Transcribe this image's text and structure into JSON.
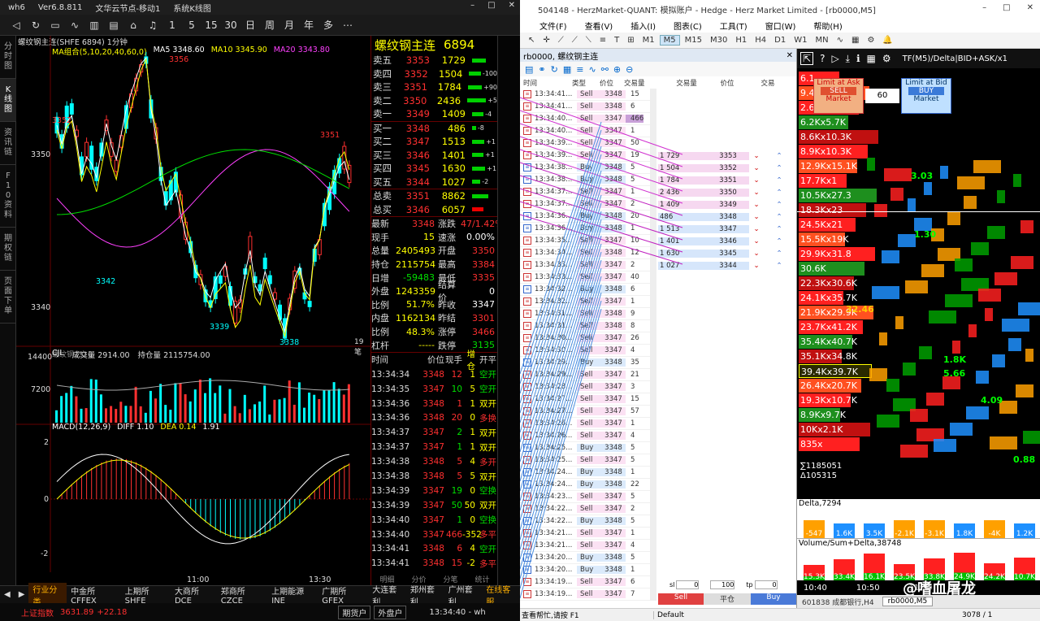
{
  "left": {
    "title": {
      "app": "wh6",
      "version": "Ver6.8.811",
      "cloud": "文华云节点-移动1",
      "kline": "系统K线图"
    },
    "toolbar": [
      "◁",
      "↻",
      "▭",
      "∿",
      "▥",
      "▤",
      "⌂",
      "♫",
      "1",
      "5",
      "15",
      "30",
      "日",
      "周",
      "月",
      "年",
      "多",
      "⋯"
    ],
    "side_tabs": [
      "分时图",
      "K线图",
      "资讯链",
      "F10资料",
      "期权链",
      "页面下单"
    ],
    "symbol_line": "螺纹钢主连(SHFE 6894)  1分钟",
    "ma_line": {
      "label": "MA组合(5,10,20,40,60,0)",
      "ma5": "MA5 3348.60",
      "ma10": "MA10 3345.90",
      "ma20": "MA20 3343.80"
    },
    "price_labels": {
      "p3356": "3356",
      "p3352": "3352",
      "p3351": "3351",
      "p3350": "3350",
      "p3342": "3342",
      "p3340": "3340",
      "p3339": "3339",
      "p3338": "3338",
      "ticks_count": "19笔"
    },
    "vol_line": {
      "label": "CJL",
      "vol": "成交量 2914.00",
      "oi": "持仓量 2115754.00",
      "y1": "14400",
      "y2": "7200",
      "watermark": "螺纹钢2510"
    },
    "macd_line": {
      "label": "MACD(12,26,9)",
      "diff": "DIFF 1.10",
      "dea": "DEA 0.14",
      "macd": "1.91",
      "y2": "2",
      "y0": "0",
      "ym2": "-2"
    },
    "x_axis": [
      "11:00",
      "13:30"
    ],
    "orderbook": {
      "name": "螺纹钢主连",
      "code": "6894",
      "asks": [
        {
          "l": "卖五",
          "p": "3353",
          "v": "1729",
          "c": ""
        },
        {
          "l": "卖四",
          "p": "3352",
          "v": "1504",
          "c": "-100"
        },
        {
          "l": "卖三",
          "p": "3351",
          "v": "1784",
          "c": "+90"
        },
        {
          "l": "卖二",
          "p": "3350",
          "v": "2436",
          "c": "+5"
        },
        {
          "l": "卖一",
          "p": "3349",
          "v": "1409",
          "c": "-4"
        }
      ],
      "bids": [
        {
          "l": "买一",
          "p": "3348",
          "v": "486",
          "c": "-8"
        },
        {
          "l": "买二",
          "p": "3347",
          "v": "1513",
          "c": "+1"
        },
        {
          "l": "买三",
          "p": "3346",
          "v": "1401",
          "c": "+1"
        },
        {
          "l": "买四",
          "p": "3345",
          "v": "1630",
          "c": "+1"
        },
        {
          "l": "买五",
          "p": "3344",
          "v": "1027",
          "c": "-2"
        }
      ],
      "total_ask": {
        "l": "总卖",
        "p": "3351",
        "v": "8862"
      },
      "total_bid": {
        "l": "总买",
        "p": "3346",
        "v": "6057"
      }
    },
    "stats": [
      {
        "k": "最新",
        "v": "3348",
        "k2": "涨跌",
        "v2": "47/1.42%"
      },
      {
        "k": "现手",
        "v": "15",
        "k2": "速涨",
        "v2": "0.00%"
      },
      {
        "k": "总量",
        "v": "2405493",
        "k2": "开盘",
        "v2": "3350"
      },
      {
        "k": "持仓",
        "v": "2115754",
        "k2": "最高",
        "v2": "3384"
      },
      {
        "k": "日增",
        "v": "-59483",
        "k2": "最低",
        "v2": "3335"
      },
      {
        "k": "外盘",
        "v": "1243359",
        "k2": "结算价",
        "v2": "0"
      },
      {
        "k": "比例",
        "v": "51.7%",
        "k2": "昨收",
        "v2": "3347"
      },
      {
        "k": "内盘",
        "v": "1162134",
        "k2": "昨结",
        "v2": "3301"
      },
      {
        "k": "比例",
        "v": "48.3%",
        "k2": "涨停",
        "v2": "3466"
      },
      {
        "k": "杠杆",
        "v": "-----",
        "k2": "跌停",
        "v2": "3135"
      }
    ],
    "ticks_header": [
      "时间",
      "价位",
      "现手",
      "增仓",
      "开平"
    ],
    "ticks": [
      [
        "13:34:34",
        "3348",
        "12",
        "1",
        "空开"
      ],
      [
        "13:34:35",
        "3347",
        "10",
        "5",
        "空开"
      ],
      [
        "13:34:36",
        "3348",
        "1",
        "1",
        "双开"
      ],
      [
        "13:34:36",
        "3348",
        "20",
        "0",
        "多换"
      ],
      [
        "13:34:37",
        "3347",
        "2",
        "1",
        "双开"
      ],
      [
        "13:34:37",
        "3347",
        "1",
        "1",
        "双开"
      ],
      [
        "13:34:38",
        "3348",
        "5",
        "4",
        "多开"
      ],
      [
        "13:34:38",
        "3348",
        "5",
        "5",
        "双开"
      ],
      [
        "13:34:39",
        "3347",
        "19",
        "0",
        "空换"
      ],
      [
        "13:34:39",
        "3347",
        "50",
        "50",
        "双开"
      ],
      [
        "13:34:40",
        "3347",
        "1",
        "0",
        "空换"
      ],
      [
        "13:34:40",
        "3347",
        "466",
        "-352",
        "多平"
      ],
      [
        "13:34:41",
        "3348",
        "6",
        "4",
        "空开"
      ],
      [
        "13:34:41",
        "3348",
        "15",
        "-2",
        "多平"
      ]
    ],
    "ticks_tabs": [
      "明细",
      "分价",
      "分笔",
      "统计"
    ],
    "bottom_tabs": [
      "◀",
      "▶",
      "行业分类",
      "中金所CFFEX",
      "上期所SHFE",
      "大商所DCE",
      "郑商所CZCE",
      "上期能源INE",
      "广期所GFEX",
      "大连套利",
      "郑州套利",
      "广州套利",
      "在线客服"
    ],
    "status": {
      "index": "上证指数",
      "val": "3631.89",
      "chg": "+22.18",
      "b1": "期货户",
      "b2": "外盘户",
      "time": "13:34:40 - wh"
    }
  },
  "right": {
    "title": "504148 - HerzMarket-QUANT: 模拟账户 - Hedge - Herz Market Limited - [rb0000,M5]",
    "menu": [
      "文件(F)",
      "查看(V)",
      "插入(I)",
      "图表(C)",
      "工具(T)",
      "窗口(W)",
      "帮助(H)"
    ],
    "tf": [
      "M1",
      "M5",
      "M15",
      "M30",
      "H1",
      "H4",
      "D1",
      "W1",
      "MN"
    ],
    "active_tf": "M5",
    "dom_head": "rb0000, 螺纹钢主连",
    "trades_header": [
      "时间",
      "类型",
      "价位",
      "交易量"
    ],
    "dom_header": [
      "交易量",
      "价位",
      "交易"
    ],
    "trades": [
      [
        "13:34:41...",
        "Sell",
        "3348",
        "15"
      ],
      [
        "13:34:41...",
        "Sell",
        "3348",
        "6"
      ],
      [
        "13:34:40...",
        "Sell",
        "3347",
        "466"
      ],
      [
        "13:34:40...",
        "Sell",
        "3347",
        "1"
      ],
      [
        "13:34:39...",
        "Sell",
        "3347",
        "50"
      ],
      [
        "13:34:39...",
        "Sell",
        "3347",
        "19"
      ],
      [
        "13:34:38...",
        "Buy",
        "3348",
        "5"
      ],
      [
        "13:34:38...",
        "Buy",
        "3348",
        "5"
      ],
      [
        "13:34:37...",
        "Sell",
        "3347",
        "1"
      ],
      [
        "13:34:37...",
        "Sell",
        "3347",
        "2"
      ],
      [
        "13:34:36...",
        "Buy",
        "3348",
        "20"
      ],
      [
        "13:34:36...",
        "Buy",
        "3348",
        "1"
      ],
      [
        "13:34:35...",
        "Sell",
        "3347",
        "10"
      ],
      [
        "13:34:34...",
        "Sell",
        "3348",
        "12"
      ],
      [
        "13:34:33...",
        "Sell",
        "3347",
        "2"
      ],
      [
        "13:34:33...",
        "Sell",
        "3347",
        "40"
      ],
      [
        "13:34:32...",
        "Buy",
        "3348",
        "6"
      ],
      [
        "13:34:32...",
        "Sell",
        "3347",
        "1"
      ],
      [
        "13:34:31...",
        "Sell",
        "3348",
        "9"
      ],
      [
        "13:34:31...",
        "Sell",
        "3348",
        "8"
      ],
      [
        "13:34:30...",
        "Sell",
        "3347",
        "26"
      ],
      [
        "13:34:30...",
        "Sell",
        "3347",
        "4"
      ],
      [
        "13:34:29...",
        "Buy",
        "3348",
        "35"
      ],
      [
        "13:34:29...",
        "Sell",
        "3347",
        "21"
      ],
      [
        "13:34:28...",
        "Sell",
        "3347",
        "3"
      ],
      [
        "13:34:27...",
        "Sell",
        "3347",
        "15"
      ],
      [
        "13:34:27...",
        "Sell",
        "3347",
        "57"
      ],
      [
        "13:34:26...",
        "Sell",
        "3347",
        "1"
      ],
      [
        "13:34:26...",
        "Sell",
        "3347",
        "4"
      ],
      [
        "13:34:25...",
        "Buy",
        "3348",
        "5"
      ],
      [
        "13:34:25...",
        "Sell",
        "3347",
        "5"
      ],
      [
        "13:34:24...",
        "Buy",
        "3348",
        "1"
      ],
      [
        "13:34:24...",
        "Buy",
        "3348",
        "22"
      ],
      [
        "13:34:23...",
        "Sell",
        "3347",
        "5"
      ],
      [
        "13:34:22...",
        "Sell",
        "3347",
        "2"
      ],
      [
        "13:34:22...",
        "Buy",
        "3348",
        "5"
      ],
      [
        "13:34:21...",
        "Sell",
        "3347",
        "1"
      ],
      [
        "13:34:21...",
        "Sell",
        "3347",
        "4"
      ],
      [
        "13:34:20...",
        "Buy",
        "3348",
        "5"
      ],
      [
        "13:34:20...",
        "Buy",
        "3348",
        "1"
      ],
      [
        "13:34:19...",
        "Sell",
        "3347",
        "6"
      ],
      [
        "13:34:19...",
        "Sell",
        "3347",
        "7"
      ]
    ],
    "dom": [
      [
        "1 729",
        "3353",
        "ask"
      ],
      [
        "1 504",
        "3352",
        "ask"
      ],
      [
        "1 784",
        "3351",
        "ask"
      ],
      [
        "2 436",
        "3350",
        "ask"
      ],
      [
        "1 409",
        "3349",
        "ask"
      ],
      [
        "486",
        "3348",
        "bid"
      ],
      [
        "1 513",
        "3347",
        "bid"
      ],
      [
        "1 401",
        "3346",
        "bid"
      ],
      [
        "1 630",
        "3345",
        "bid"
      ],
      [
        "1 027",
        "3344",
        "bid"
      ]
    ],
    "dom_controls": {
      "sl": "sl",
      "sl_v": "0",
      "qty": "100",
      "tp": "tp",
      "tp_v": "0",
      "sell": "Sell",
      "flat": "平仓",
      "buy": "Buy"
    },
    "fp": {
      "header": "TF(M5)/Delta|BID+ASK/x1",
      "ask_btn": [
        "Limit at Ask",
        "SELL",
        "Market"
      ],
      "bid_btn": [
        "Limit at Bid",
        "BUY",
        "Market"
      ],
      "qty": "60",
      "rows": [
        "6.1",
        "9.4",
        "2.6",
        "6.2Kx5.7K",
        "8.6Kx10.3K",
        "8.9Kx10.3K",
        "12.9Kx15.1K",
        "17.7Kx1",
        "10.5Kx27.3",
        "18.3Kx23",
        "24.5Kx21",
        "15.5Kx19K",
        "29.9Kx31.8",
        "30.6K",
        "22.3Kx30.6K",
        "24.1Kx35.7K",
        "21.9Kx29.9K",
        "23.7Kx41.2K",
        "35.4Kx40.7K",
        "35.1Kx34.8K",
        "39.4Kx39.7K",
        "26.4Kx20.7K",
        "19.3Kx10.7K",
        "8.9Kx9.7K",
        "10Kx2.1K",
        "835x"
      ],
      "labels": [
        "3.03",
        "1.30",
        "32.46",
        "1.8K",
        "5.66",
        "4.09",
        "0.88"
      ],
      "sum": "∑1185051",
      "delta": "Δ105315",
      "delta_title": "Delta,7294",
      "delta_vals": [
        "-547",
        "1.6K",
        "3.5K",
        "-2.1K",
        "-3.1K",
        "1.8K",
        "-4K",
        "1.2K"
      ],
      "vol_title": "Volume/Sum+Delta,38748",
      "vol_vals": [
        "15.3K",
        "33.4K",
        "16.1K",
        "23.5K",
        "33.8K",
        "24.9K",
        "24.2K",
        "10.7K"
      ],
      "times": [
        "10:40",
        "10:50",
        "11:00"
      ],
      "tabs": [
        "601838 成都银行,H4",
        "rb0000,M5"
      ],
      "watermark": "@嗜血屠龙"
    },
    "status": {
      "help": "查看帮忙,请按 F1",
      "profile": "Default",
      "bars": "3078 / 1"
    }
  },
  "colors": {
    "up": "#ff3030",
    "down": "#00ffff",
    "ma5": "#ffffff",
    "ma10": "#ffff00",
    "ma20": "#ff40ff"
  }
}
